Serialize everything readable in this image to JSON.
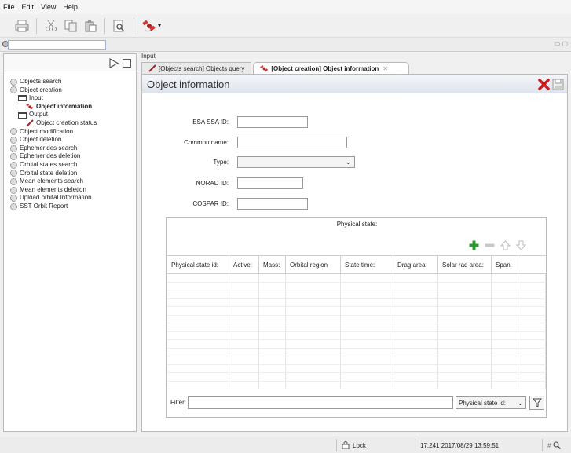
{
  "menu": [
    "File",
    "Edit",
    "View",
    "Help"
  ],
  "left_panel": {
    "tree": [
      {
        "label": "Objects search",
        "icon": "gear-icon",
        "level": 0,
        "selected": false
      },
      {
        "label": "Object creation",
        "icon": "gear-icon",
        "level": 0,
        "selected": false
      },
      {
        "label": "Input",
        "icon": "folder-icon",
        "level": 1,
        "selected": false
      },
      {
        "label": "Object information",
        "icon": "satellite-icon",
        "level": 2,
        "selected": true
      },
      {
        "label": "Output",
        "icon": "folder-icon",
        "level": 1,
        "selected": false
      },
      {
        "label": "Object creation status",
        "icon": "pencil-icon",
        "level": 2,
        "selected": false
      },
      {
        "label": "Object modification",
        "icon": "gear-icon",
        "level": 0,
        "selected": false
      },
      {
        "label": "Object deletion",
        "icon": "gear-icon",
        "level": 0,
        "selected": false
      },
      {
        "label": "Ephemerides search",
        "icon": "gear-icon",
        "level": 0,
        "selected": false
      },
      {
        "label": "Ephemerides deletion",
        "icon": "gear-icon",
        "level": 0,
        "selected": false
      },
      {
        "label": "Orbital states search",
        "icon": "gear-icon",
        "level": 0,
        "selected": false
      },
      {
        "label": "Orbital state deletion",
        "icon": "gear-icon",
        "level": 0,
        "selected": false
      },
      {
        "label": "Mean elements search",
        "icon": "gear-icon",
        "level": 0,
        "selected": false
      },
      {
        "label": "Mean elements deletion",
        "icon": "gear-icon",
        "level": 0,
        "selected": false
      },
      {
        "label": "Upload orbital Information",
        "icon": "gear-icon",
        "level": 0,
        "selected": false
      },
      {
        "label": "SST Orbit Report",
        "icon": "gear-icon",
        "level": 0,
        "selected": false
      }
    ]
  },
  "right_area": {
    "label": "Input",
    "tabs": [
      {
        "label": "[Objects search] Objects query",
        "active": false
      },
      {
        "label": "[Object creation] Object information",
        "active": true
      }
    ]
  },
  "editor": {
    "title": "Object information",
    "fields": {
      "esa_ssa_id": {
        "label": "ESA SSA ID:",
        "value": ""
      },
      "common_name": {
        "label": "Common name:",
        "value": ""
      },
      "type": {
        "label": "Type:",
        "value": ""
      },
      "norad_id": {
        "label": "NORAD ID:",
        "value": ""
      },
      "cospar_id": {
        "label": "COSPAR ID:",
        "value": ""
      }
    },
    "physical_state": {
      "title": "Physical state:",
      "columns": [
        "Physical state id:",
        "Active:",
        "Mass:",
        "Orbital region",
        "State time:",
        "Drag area:",
        "Solar rad area:",
        "Span:"
      ],
      "rows": [],
      "filter_label": "Filter:",
      "filter_value": "",
      "filter_column": "Physical state id:"
    }
  },
  "status": {
    "lock_label": "Lock",
    "info": "17.241 2017/08/29 13:59:51"
  },
  "colors": {
    "accent_green": "#2e9a2e",
    "close_red": "#d01818",
    "selection_blue": "#9fb4d6"
  }
}
